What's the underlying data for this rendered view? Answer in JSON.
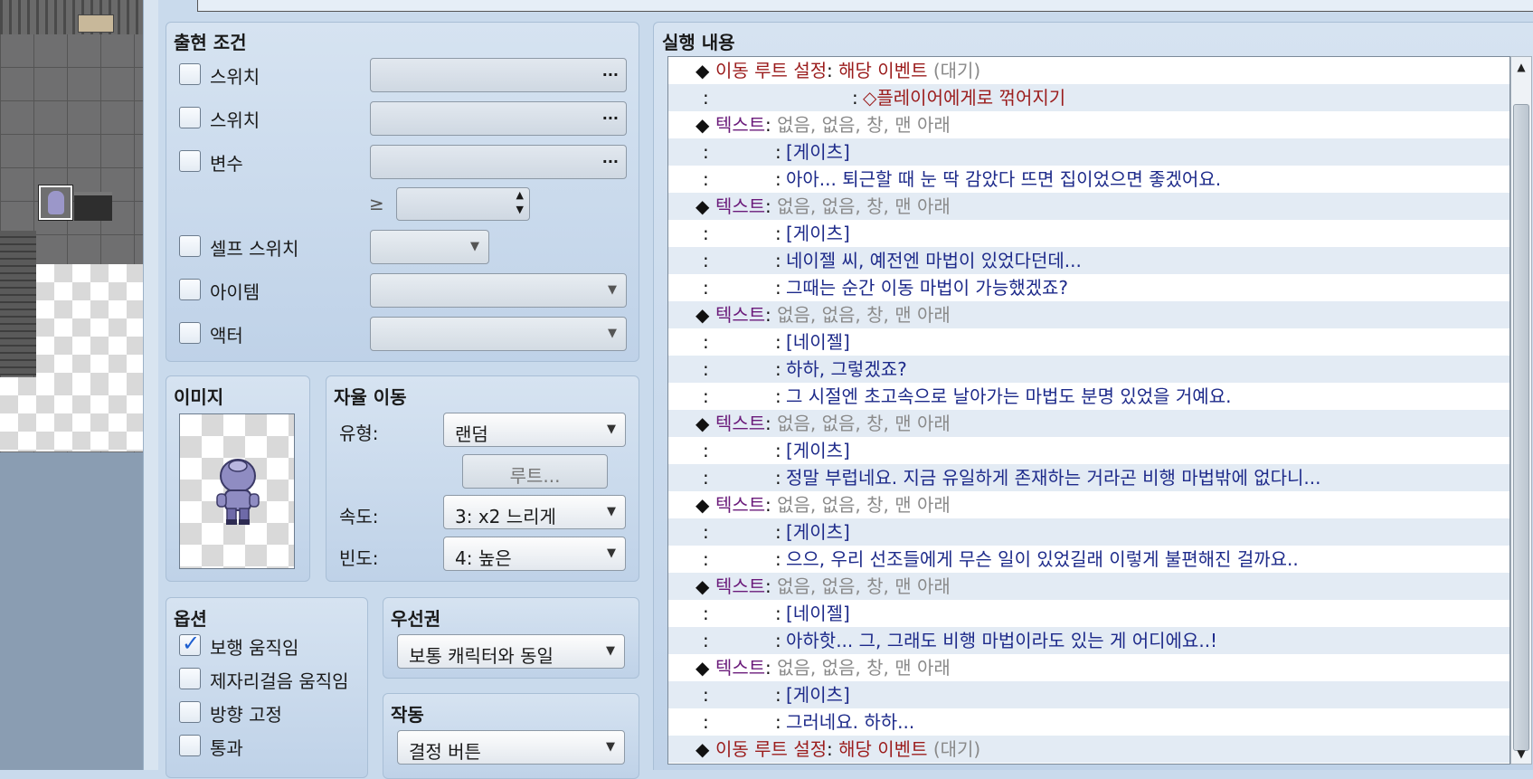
{
  "conditions": {
    "title": "출현 조건",
    "switch1_label": "스위치",
    "switch2_label": "스위치",
    "variable_label": "변수",
    "ge_symbol": "≥",
    "self_switch_label": "셀프 스위치",
    "item_label": "아이템",
    "actor_label": "액터",
    "dots": "···",
    "arrow": "▼",
    "spin_up": "▲",
    "spin_down": "▼"
  },
  "image": {
    "title": "이미지"
  },
  "autonomous": {
    "title": "자율 이동",
    "type_label": "유형:",
    "type_value": "랜덤",
    "route_button": "루트...",
    "speed_label": "속도:",
    "speed_value": "3: x2 느리게",
    "freq_label": "빈도:",
    "freq_value": "4: 높은"
  },
  "options": {
    "title": "옵션",
    "walk_anim": "보행 움직임",
    "walk_anim_checked": true,
    "stepping_anim": "제자리걸음 움직임",
    "direction_fix": "방향 고정",
    "through": "통과"
  },
  "priority": {
    "title": "우선권",
    "value": "보통 캐릭터와 동일"
  },
  "trigger": {
    "title": "작동",
    "value": "결정 버튼"
  },
  "contents": {
    "title": "실행 내용",
    "scroll_up": "▲",
    "scroll_down": "▼",
    "rows": [
      {
        "type": "head",
        "cmd": "이동 루트 설정",
        "sep": " : ",
        "a": "해당 이벤트",
        "b": " (대기)",
        "cmdColor": "red",
        "aColor": "red"
      },
      {
        "type": "cont",
        "text": "◇플레이어에게로 꺾어지기",
        "color": "red",
        "indent": "wide"
      },
      {
        "type": "head",
        "cmd": "텍스트",
        "sep": " : ",
        "a": "없음, 없음, 창, 맨 아래",
        "b": "",
        "cmdColor": "pur",
        "aColor": "gray"
      },
      {
        "type": "cont",
        "text": "[게이츠]",
        "color": "blue"
      },
      {
        "type": "cont",
        "text": "아아... 퇴근할 때 눈 딱 감았다 뜨면 집이었으면 좋겠어요.",
        "color": "blue"
      },
      {
        "type": "head",
        "cmd": "텍스트",
        "sep": " : ",
        "a": "없음, 없음, 창, 맨 아래",
        "b": "",
        "cmdColor": "pur",
        "aColor": "gray"
      },
      {
        "type": "cont",
        "text": "[게이츠]",
        "color": "blue"
      },
      {
        "type": "cont",
        "text": "네이젤 씨, 예전엔 마법이 있었다던데...",
        "color": "blue"
      },
      {
        "type": "cont",
        "text": "그때는 순간 이동 마법이 가능했겠죠?",
        "color": "blue"
      },
      {
        "type": "head",
        "cmd": "텍스트",
        "sep": " : ",
        "a": "없음, 없음, 창, 맨 아래",
        "b": "",
        "cmdColor": "pur",
        "aColor": "gray"
      },
      {
        "type": "cont",
        "text": "[네이젤]",
        "color": "blue"
      },
      {
        "type": "cont",
        "text": "하하, 그렇겠죠?",
        "color": "blue"
      },
      {
        "type": "cont",
        "text": "그 시절엔 초고속으로 날아가는 마법도 분명 있었을 거예요.",
        "color": "blue"
      },
      {
        "type": "head",
        "cmd": "텍스트",
        "sep": " : ",
        "a": "없음, 없음, 창, 맨 아래",
        "b": "",
        "cmdColor": "pur",
        "aColor": "gray"
      },
      {
        "type": "cont",
        "text": "[게이츠]",
        "color": "blue"
      },
      {
        "type": "cont",
        "text": "정말 부럽네요. 지금 유일하게 존재하는 거라곤 비행 마법밖에 없다니...",
        "color": "blue"
      },
      {
        "type": "head",
        "cmd": "텍스트",
        "sep": " : ",
        "a": "없음, 없음, 창, 맨 아래",
        "b": "",
        "cmdColor": "pur",
        "aColor": "gray"
      },
      {
        "type": "cont",
        "text": "[게이츠]",
        "color": "blue"
      },
      {
        "type": "cont",
        "text": "으으, 우리 선조들에게 무슨 일이 있었길래 이렇게 불편해진 걸까요..",
        "color": "blue"
      },
      {
        "type": "head",
        "cmd": "텍스트",
        "sep": " : ",
        "a": "없음, 없음, 창, 맨 아래",
        "b": "",
        "cmdColor": "pur",
        "aColor": "gray"
      },
      {
        "type": "cont",
        "text": "[네이젤]",
        "color": "blue"
      },
      {
        "type": "cont",
        "text": "아하핫... 그, 그래도 비행 마법이라도 있는 게 어디에요..!",
        "color": "blue"
      },
      {
        "type": "head",
        "cmd": "텍스트",
        "sep": " : ",
        "a": "없음, 없음, 창, 맨 아래",
        "b": "",
        "cmdColor": "pur",
        "aColor": "gray"
      },
      {
        "type": "cont",
        "text": "[게이츠]",
        "color": "blue"
      },
      {
        "type": "cont",
        "text": "그러네요. 하하...",
        "color": "blue"
      },
      {
        "type": "head",
        "cmd": "이동 루트 설정",
        "sep": " : ",
        "a": "해당 이벤트",
        "b": " (대기)",
        "cmdColor": "red",
        "aColor": "red"
      }
    ]
  },
  "glyphs": {
    "diamond": "◆",
    "colon": ":"
  },
  "colors": {
    "red": "#9b1c1c",
    "pur": "#6a1a7a",
    "gray": "#8a8a8a",
    "blue": "#1d2a8a",
    "check": "#1d5fd0"
  }
}
